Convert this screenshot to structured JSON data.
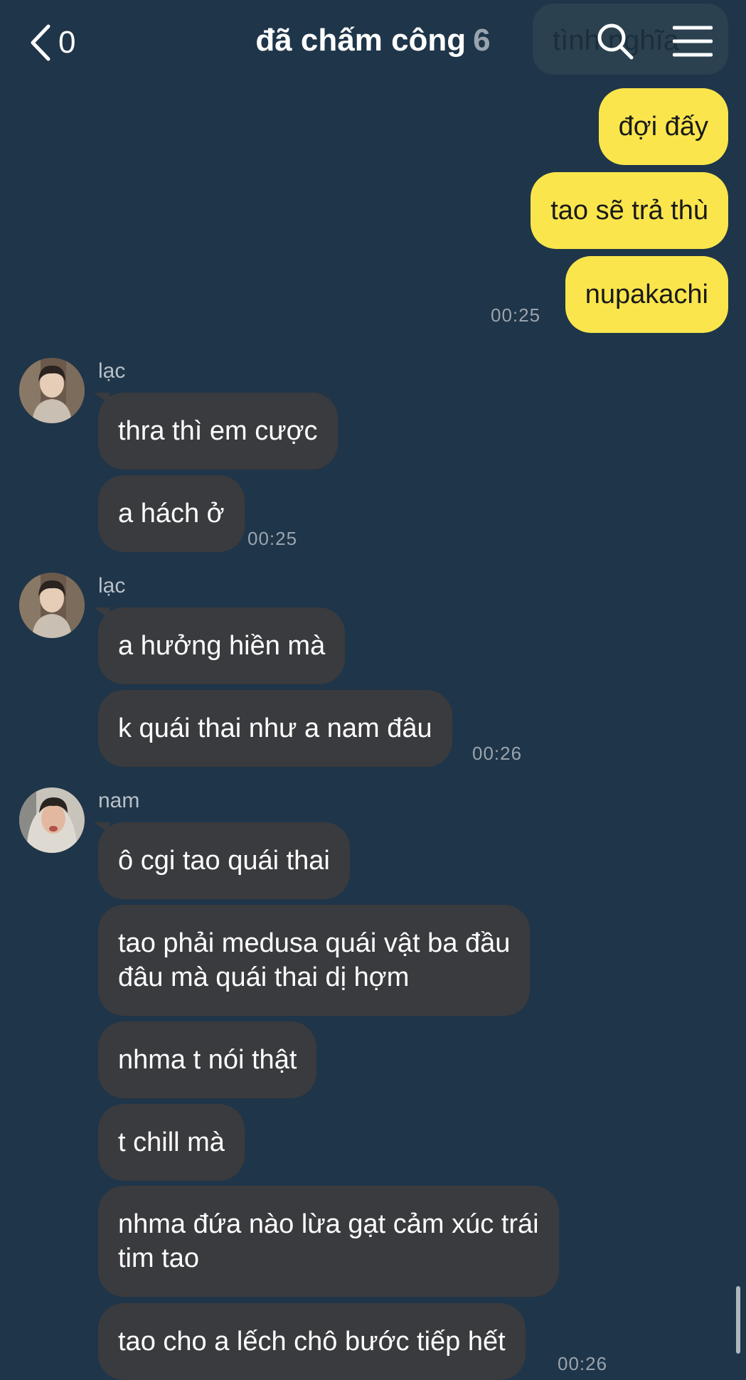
{
  "header": {
    "back_count": "0",
    "title": "đã chấm công",
    "member_count": "6",
    "notice_text": "tình nghĩa"
  },
  "icons": {
    "back": "chevron-left-icon",
    "search": "search-icon",
    "menu": "hamburger-menu-icon"
  },
  "colors": {
    "background": "#1f3549",
    "my_bubble": "#fae64c",
    "their_bubble": "#3a3b3e"
  },
  "messages": {
    "mine": [
      {
        "text": "đợi đấy"
      },
      {
        "text": "tao sẽ trả thù"
      },
      {
        "text": "nupakachi",
        "time": "00:25"
      }
    ],
    "group1": {
      "sender": "lạc",
      "items": [
        {
          "text": "thra thì em cược"
        },
        {
          "text": "a hách ở",
          "time": "00:25"
        }
      ]
    },
    "group2": {
      "sender": "lạc",
      "items": [
        {
          "text": "a hưởng hiền mà"
        },
        {
          "text": "k quái thai như a nam đâu",
          "time": "00:26"
        }
      ]
    },
    "group3": {
      "sender": "nam",
      "items": [
        {
          "text": "ô cgi tao quái thai"
        },
        {
          "text": "tao phải medusa quái vật ba đầu\nđâu mà quái thai dị hợm"
        },
        {
          "text": "nhma t nói thật"
        },
        {
          "text": "t chill mà"
        },
        {
          "text": "nhma đứa nào lừa gạt cảm xúc trái\ntim tao"
        },
        {
          "text": "tao cho a lếch chô bước tiếp hết",
          "time": "00:26"
        }
      ]
    }
  }
}
